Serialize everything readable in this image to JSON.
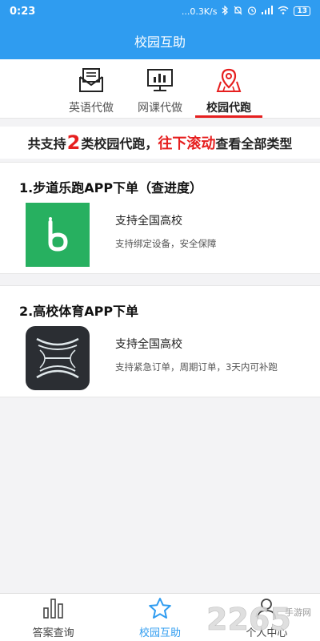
{
  "status_bar": {
    "time": "0:23",
    "speed": "...0.3K/s",
    "battery": "13"
  },
  "header": {
    "title": "校园互助"
  },
  "tabs": [
    {
      "label": "英语代做",
      "icon": "envelope-icon",
      "active": false
    },
    {
      "label": "网课代做",
      "icon": "monitor-chart-icon",
      "active": false
    },
    {
      "label": "校园代跑",
      "icon": "map-pin-icon",
      "active": true
    }
  ],
  "banner": {
    "prefix": "共支持",
    "count": "2",
    "middle": "类校园代跑，",
    "highlight": "往下滚动",
    "suffix": "查看全部类型"
  },
  "cards": [
    {
      "title": "1.步道乐跑APP下单（查进度）",
      "line1": "支持全国高校",
      "line2": "支持绑定设备，安全保障",
      "logo": "buddao-app-logo",
      "logo_color": "#27b060"
    },
    {
      "title": "2.高校体育APP下单",
      "line1": "支持全国高校",
      "line2": "支持紧急订单，周期订单，3天内可补跑",
      "logo": "gaoxiao-tiyu-app-logo",
      "logo_color": "#2b2e33"
    }
  ],
  "bottom_nav": [
    {
      "label": "答案查询",
      "icon": "bar-chart-icon",
      "active": false
    },
    {
      "label": "校园互助",
      "icon": "star-icon",
      "active": true
    },
    {
      "label": "个人中心",
      "icon": "person-icon",
      "active": false
    }
  ],
  "watermark": {
    "brand": "2265",
    "text": "手游网"
  },
  "colors": {
    "primary": "#2f9cf0",
    "accent_red": "#e61f1f",
    "background": "#f3f3f5"
  }
}
